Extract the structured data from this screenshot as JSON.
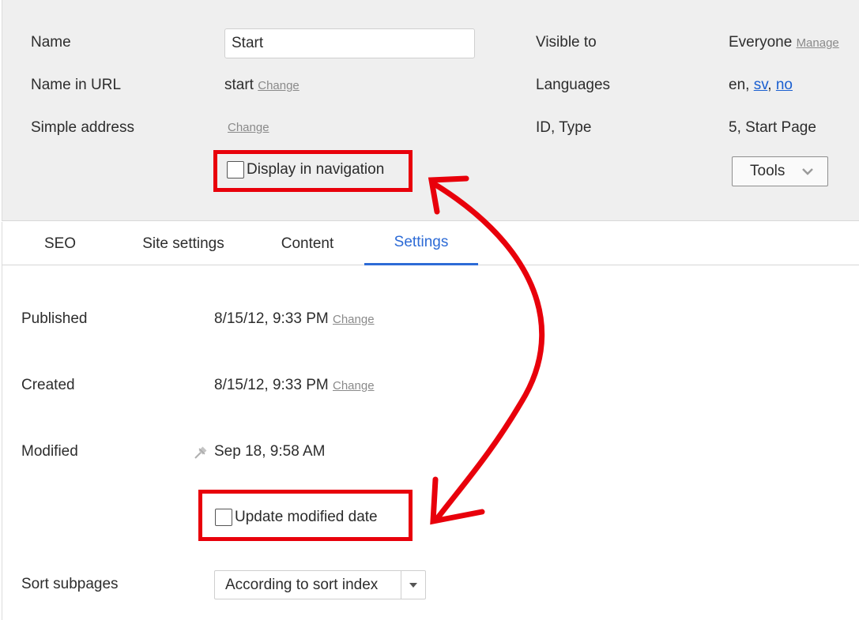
{
  "header": {
    "name_label": "Name",
    "name_value": "Start",
    "name_in_url_label": "Name in URL",
    "name_in_url_value": "start",
    "simple_address_label": "Simple address",
    "change_link": "Change",
    "display_in_nav_label": "Display in navigation",
    "visible_to_label": "Visible to",
    "visible_to_value": "Everyone",
    "manage_link": "Manage",
    "languages_label": "Languages",
    "languages_prefix": "en, ",
    "lang_sv": "sv",
    "lang_sep": ", ",
    "lang_no": "no",
    "id_type_label": "ID, Type",
    "id_type_value": "5, Start Page",
    "tools_label": "Tools"
  },
  "tabs": [
    {
      "label": "SEO"
    },
    {
      "label": "Site settings"
    },
    {
      "label": "Content"
    },
    {
      "label": "Settings",
      "active": true
    }
  ],
  "settings": {
    "published_label": "Published",
    "published_value": "8/15/12, 9:33 PM",
    "created_label": "Created",
    "created_value": "8/15/12, 9:33 PM",
    "change_link": "Change",
    "modified_label": "Modified",
    "modified_value": "Sep 18, 9:58 AM",
    "update_modified_label": "Update modified date",
    "sort_subpages_label": "Sort subpages",
    "sort_subpages_value": "According to sort index"
  },
  "colors": {
    "accent": "#2d6bd6",
    "annotation": "#e8000b",
    "panel_bg": "#efefef"
  },
  "icons": {
    "modified_icon": "pin-icon",
    "tools_chevron": "chevron-down-icon",
    "select_caret": "caret-down-icon"
  }
}
